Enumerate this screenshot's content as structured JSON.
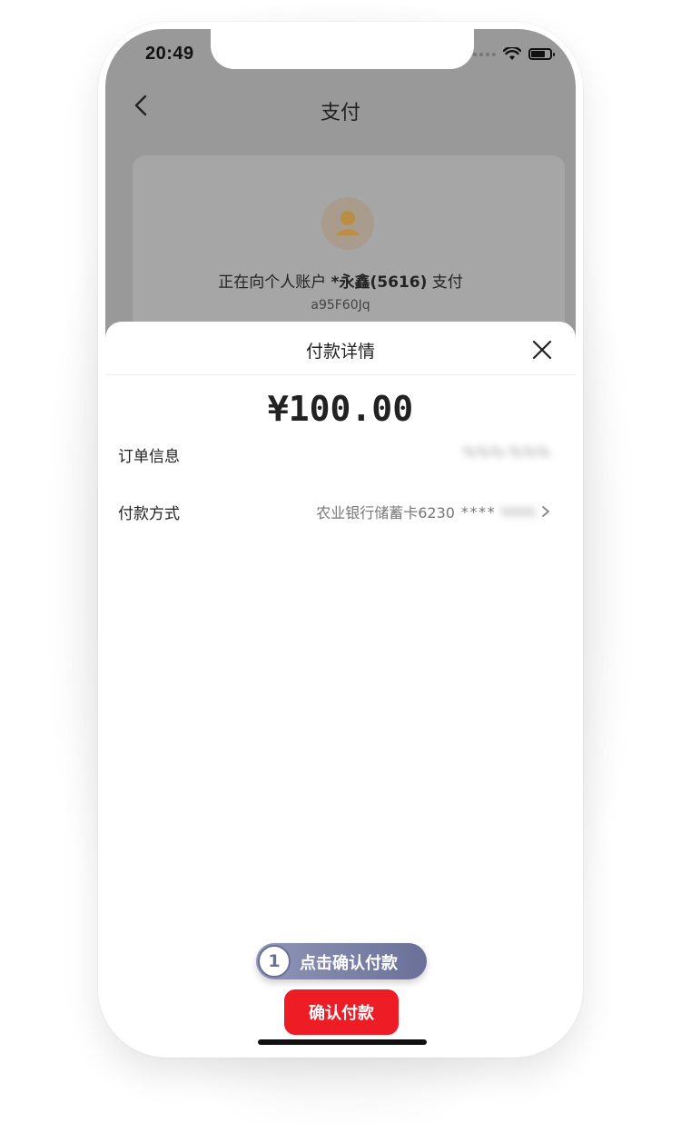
{
  "status_bar": {
    "time": "20:49"
  },
  "nav": {
    "title": "支付"
  },
  "payee": {
    "prefix": "正在向个人账户",
    "name": "*永鑫(5616)",
    "suffix": "支付",
    "account": "a95F60Jq"
  },
  "sheet": {
    "title": "付款详情",
    "amount": "¥100.00",
    "order_label": "订单信息",
    "order_value": "%%%-%%%",
    "method_label": "付款方式",
    "method_bank": "农业银行储蓄卡6230",
    "method_mask": "****",
    "method_tail": "%%%%"
  },
  "hint": {
    "step": "1",
    "text": "点击确认付款"
  },
  "confirm_button": {
    "label": "确认付款"
  },
  "colors": {
    "accent": "#ee1c25",
    "hint": "#6a7098"
  }
}
